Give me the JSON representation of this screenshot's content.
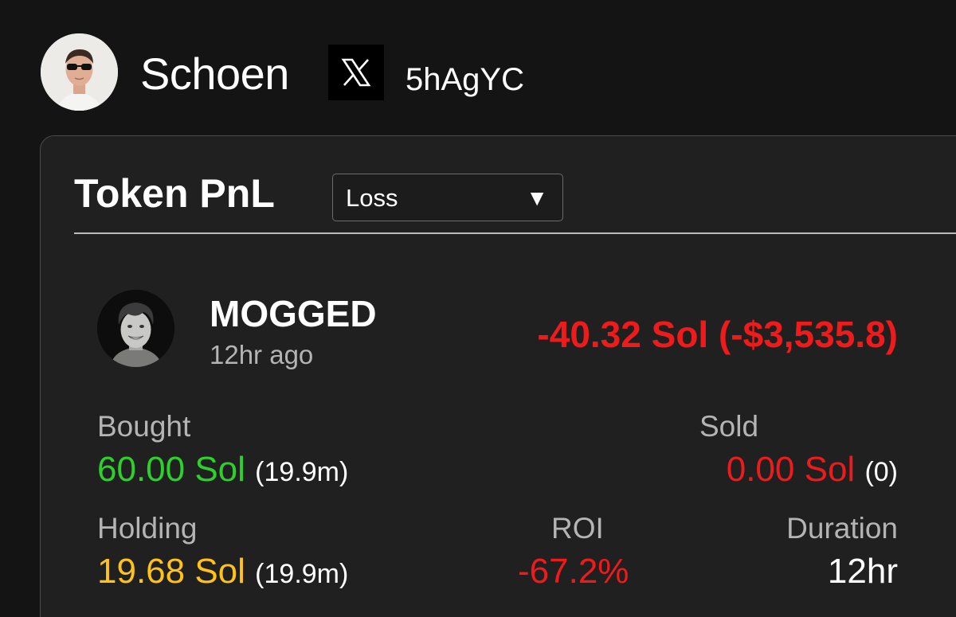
{
  "profile": {
    "username": "Schoen",
    "wallet": "5hAgYC",
    "social_icon": "x-logo-icon"
  },
  "card": {
    "title": "Token PnL",
    "filter": {
      "selected": "Loss",
      "caret": "▼"
    }
  },
  "token": {
    "name": "MOGGED",
    "time_ago": "12hr ago",
    "pnl": "-40.32 Sol (-$3,535.8)"
  },
  "stats": {
    "bought": {
      "label": "Bought",
      "value": "60.00 Sol",
      "sub": "(19.9m)"
    },
    "sold": {
      "label": "Sold",
      "value": "0.00 Sol",
      "sub": "(0)"
    },
    "holding": {
      "label": "Holding",
      "value": "19.68 Sol",
      "sub": "(19.9m)"
    },
    "roi": {
      "label": "ROI",
      "value": "-67.2%"
    },
    "duration": {
      "label": "Duration",
      "value": "12hr"
    }
  },
  "colors": {
    "positive": "#2cd12c",
    "negative": "#ed1b1b",
    "holding": "#ffc21a",
    "card_bg": "#202020",
    "page_bg": "#141414"
  }
}
